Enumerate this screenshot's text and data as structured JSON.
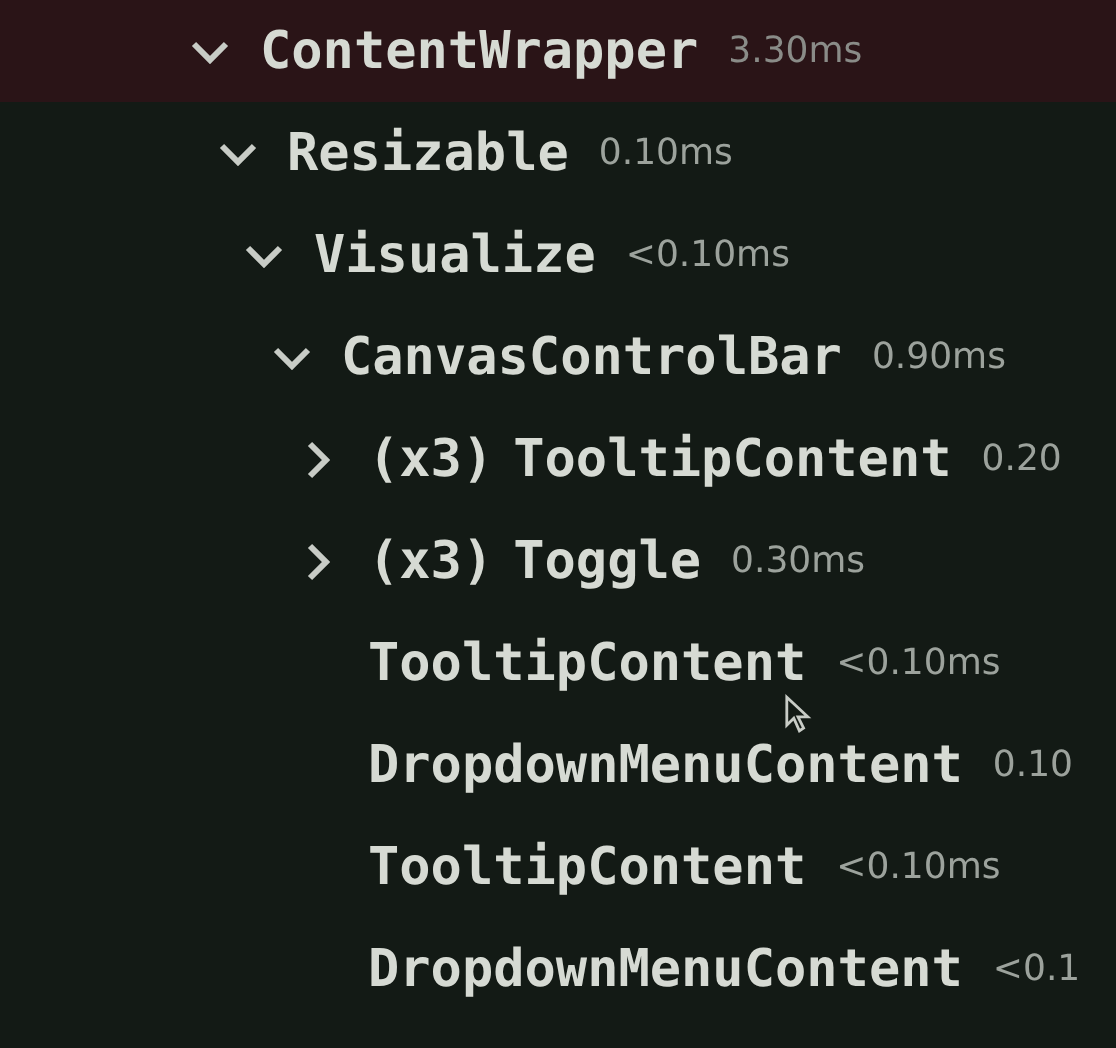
{
  "tree": [
    {
      "name": "ContentWrapper",
      "time": "3.30ms",
      "selected": true,
      "expanded": true,
      "children": [
        {
          "name": "Resizable",
          "time": "0.10ms",
          "selected": false,
          "expanded": true,
          "children": [
            {
              "name": "Visualize",
              "time": "<0.10ms",
              "selected": false,
              "expanded": true,
              "children": [
                {
                  "name": "CanvasControlBar",
                  "time": "0.90ms",
                  "selected": false,
                  "expanded": true,
                  "children": [
                    {
                      "count": "(x3)",
                      "name": "TooltipContent",
                      "time": "0.20",
                      "selected": false,
                      "expanded": false
                    },
                    {
                      "count": "(x3)",
                      "name": "Toggle",
                      "time": "0.30ms",
                      "selected": false,
                      "expanded": false
                    },
                    {
                      "name": "TooltipContent",
                      "time": "<0.10ms",
                      "selected": false
                    },
                    {
                      "name": "DropdownMenuContent",
                      "time": "0.10",
                      "selected": false
                    },
                    {
                      "name": "TooltipContent",
                      "time": "<0.10ms",
                      "selected": false
                    },
                    {
                      "name": "DropdownMenuContent",
                      "time": "<0.1",
                      "selected": false
                    }
                  ]
                }
              ]
            }
          ]
        }
      ]
    }
  ]
}
